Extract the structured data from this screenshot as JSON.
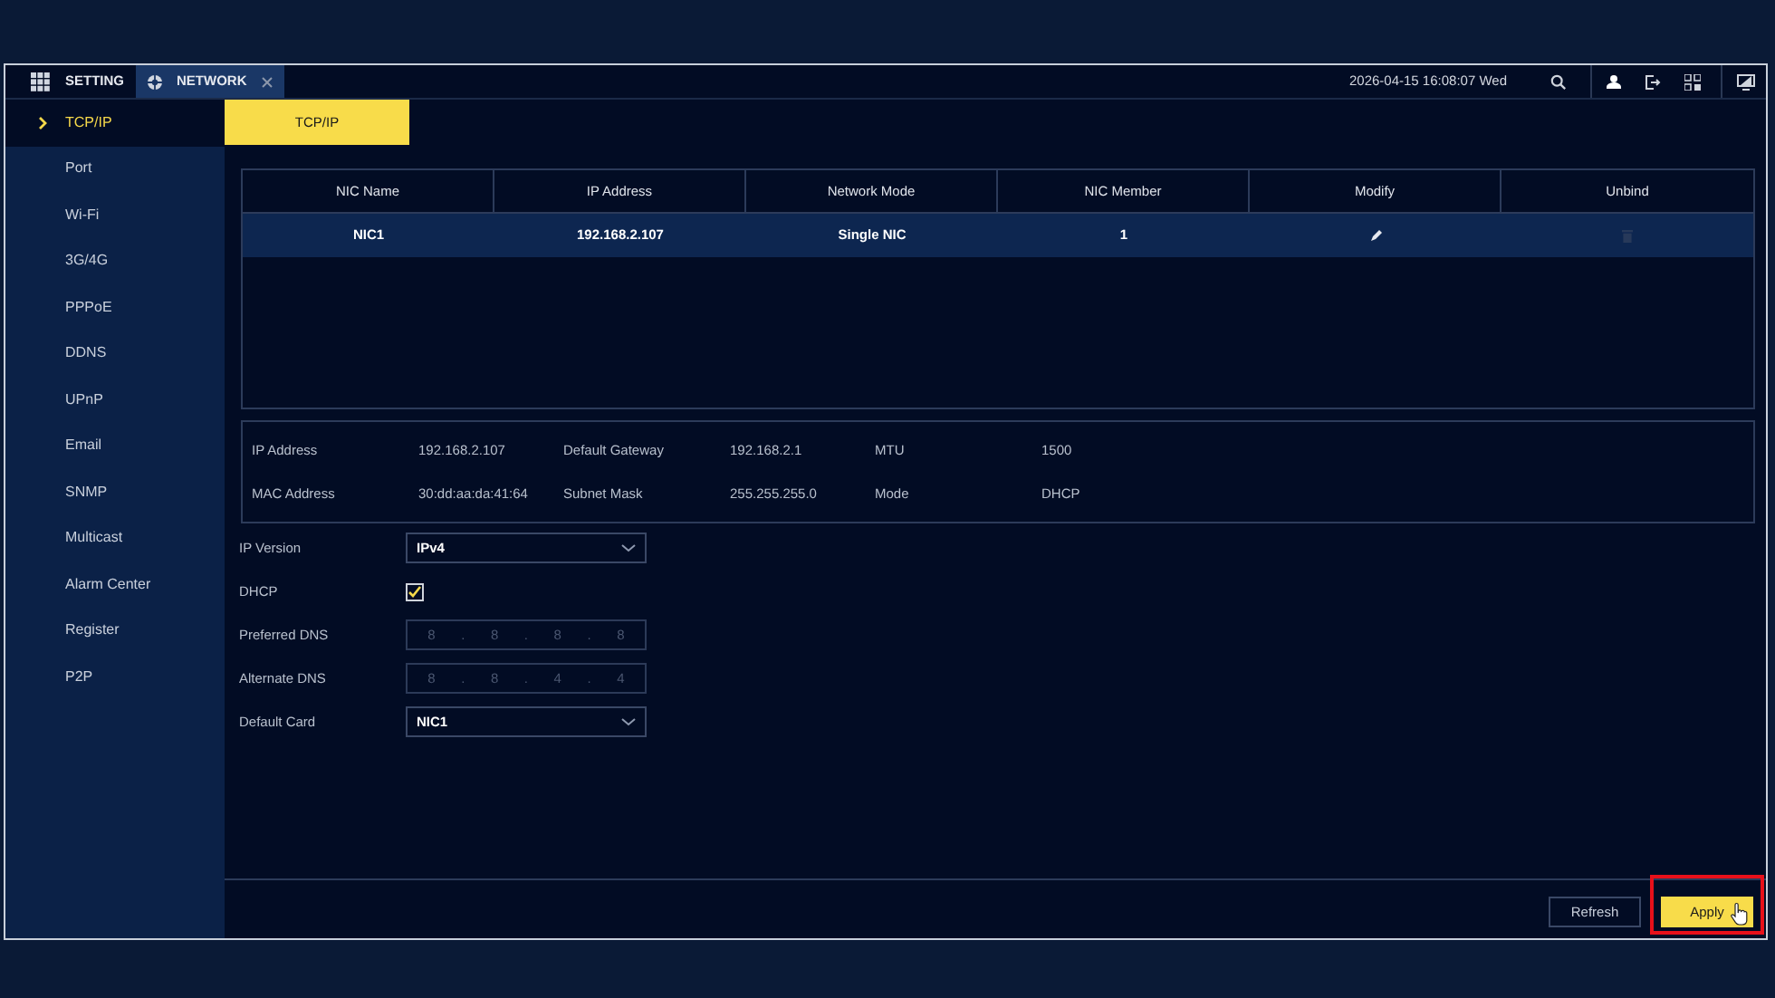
{
  "header": {
    "tabs": [
      {
        "label": "SETTING",
        "selected": false,
        "kind": "home"
      },
      {
        "label": "NETWORK",
        "selected": true,
        "kind": "page"
      }
    ],
    "datetime": "2026-04-15 16:08:07 Wed"
  },
  "sidebar": {
    "items": [
      {
        "label": "TCP/IP",
        "selected": true
      },
      {
        "label": "Port",
        "selected": false
      },
      {
        "label": "Wi-Fi",
        "selected": false
      },
      {
        "label": "3G/4G",
        "selected": false
      },
      {
        "label": "PPPoE",
        "selected": false
      },
      {
        "label": "DDNS",
        "selected": false
      },
      {
        "label": "UPnP",
        "selected": false
      },
      {
        "label": "Email",
        "selected": false
      },
      {
        "label": "SNMP",
        "selected": false
      },
      {
        "label": "Multicast",
        "selected": false
      },
      {
        "label": "Alarm Center",
        "selected": false
      },
      {
        "label": "Register",
        "selected": false
      },
      {
        "label": "P2P",
        "selected": false
      }
    ]
  },
  "subtabs": [
    {
      "label": "TCP/IP",
      "selected": true
    }
  ],
  "nic_table": {
    "columns": [
      "NIC Name",
      "IP Address",
      "Network Mode",
      "NIC Member",
      "Modify",
      "Unbind"
    ],
    "rows": [
      {
        "cells": [
          "NIC1",
          "192.168.2.107",
          "Single NIC",
          "1"
        ],
        "selected": true,
        "unbind_disabled": true
      }
    ]
  },
  "info": [
    [
      {
        "label": "IP Address",
        "value": "192.168.2.107"
      },
      {
        "label": "Default Gateway",
        "value": "192.168.2.1"
      },
      {
        "label": "MTU",
        "value": "1500"
      }
    ],
    [
      {
        "label": "MAC Address",
        "value": "30:dd:aa:da:41:64"
      },
      {
        "label": "Subnet Mask",
        "value": "255.255.255.0"
      },
      {
        "label": "Mode",
        "value": "DHCP"
      }
    ]
  ],
  "form": [
    {
      "kind": "select",
      "label": "IP Version",
      "value": "IPv4"
    },
    {
      "kind": "checkbox",
      "label": "DHCP",
      "checked": true
    },
    {
      "kind": "ip",
      "label": "Preferred DNS",
      "octets": [
        "8",
        "8",
        "8",
        "8"
      ],
      "separator": ".",
      "disabled": true
    },
    {
      "kind": "ip",
      "label": "Alternate DNS",
      "octets": [
        "8",
        "8",
        "4",
        "4"
      ],
      "separator": ".",
      "disabled": true
    },
    {
      "kind": "select",
      "label": "Default Card",
      "value": "NIC1"
    }
  ],
  "buttons": [
    {
      "label": "Refresh",
      "kind": "secondary",
      "highlighted": false
    },
    {
      "label": "Apply",
      "kind": "primary",
      "highlighted": true
    }
  ]
}
